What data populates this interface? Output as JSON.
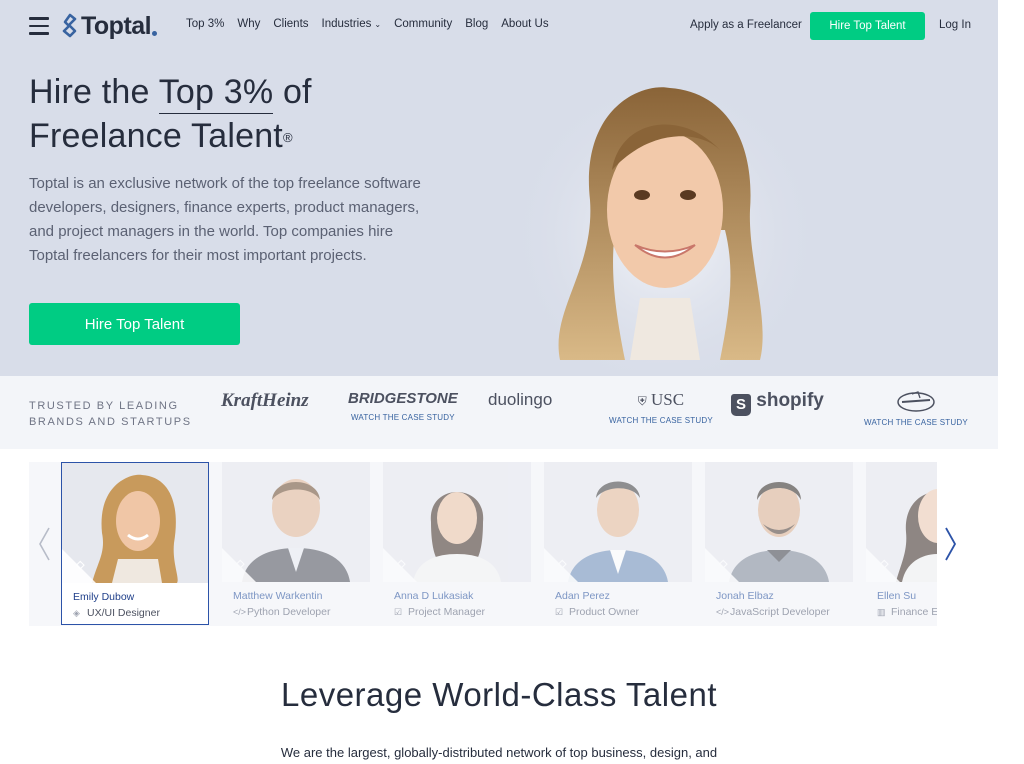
{
  "nav": {
    "logo_text": "Toptal",
    "links": [
      "Top 3%",
      "Why",
      "Clients",
      "Industries",
      "Community",
      "Blog",
      "About Us"
    ],
    "apply": "Apply as a Freelancer",
    "hire": "Hire Top Talent",
    "login": "Log In"
  },
  "hero": {
    "title_pre": "Hire the ",
    "title_underlined": "Top 3%",
    "title_post": " of",
    "title_line2": "Freelance Talent",
    "title_reg": "®",
    "description": "Toptal is an exclusive network of the top freelance software developers, designers, finance experts, product managers, and project managers in the world. Top companies hire Toptal freelancers for their most important projects.",
    "cta": "Hire Top Talent"
  },
  "trusted": {
    "label_line1": "TRUSTED BY LEADING",
    "label_line2": "BRANDS AND STARTUPS",
    "brands": [
      {
        "name": "KraftHeinz",
        "case": ""
      },
      {
        "name": "BRIDGESTONE",
        "case": "WATCH THE CASE STUDY"
      },
      {
        "name": "duolingo",
        "case": ""
      },
      {
        "name": "USC",
        "case": "WATCH THE CASE STUDY"
      },
      {
        "name": "shopify",
        "case": ""
      },
      {
        "name": "Cavaliers",
        "case": "WATCH THE CASE STUDY"
      }
    ]
  },
  "talent": [
    {
      "name": "Emily Dubow",
      "role": "UX/UI Designer"
    },
    {
      "name": "Matthew Warkentin",
      "role": "Python Developer"
    },
    {
      "name": "Anna D Lukasiak",
      "role": "Project Manager"
    },
    {
      "name": "Adan Perez",
      "role": "Product Owner"
    },
    {
      "name": "Jonah Elbaz",
      "role": "JavaScript Developer"
    },
    {
      "name": "Ellen Su",
      "role": "Finance E"
    }
  ],
  "section": {
    "title": "Leverage World-Class Talent",
    "text": "We are the largest, globally-distributed network of top business, design, and"
  },
  "colors": {
    "accent_green": "#00cc83",
    "brand_blue": "#3863a0",
    "hero_bg": "#d8dde9"
  }
}
